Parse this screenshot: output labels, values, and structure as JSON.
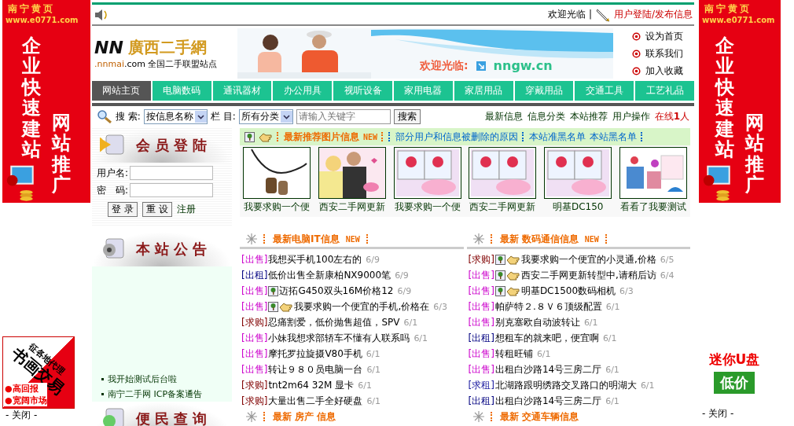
{
  "left_ads": {
    "banner": {
      "site": "南宁黄页",
      "url": "www.e0771.com",
      "slogan": "企业快速建站",
      "slogan2": "网站推广"
    },
    "float": {
      "tag": "征各地代理",
      "title": "书画交易",
      "points": [
        "●高回报",
        "●宽阔市场"
      ],
      "close": "- 关闭 -"
    }
  },
  "right_ads": {
    "banner": {
      "site": "南宁黄页",
      "url": "www.e0771.com",
      "slogan": "企业快速建站",
      "slogan2": "网站推广"
    },
    "float": {
      "title": "迷你U盘",
      "price": "低价",
      "close": "- 关闭 -"
    }
  },
  "header": {
    "welcome": "欢迎光临 |",
    "login_link": "用户登陆/发布信息"
  },
  "logo": {
    "mark": "NN",
    "name": "廣西二手網",
    "domain": ".nnmai",
    "suffix": ".com 全国二手联盟站点"
  },
  "banner": {
    "kind": "picture",
    "welcome": "欢迎光临:",
    "site": "nngw.cn"
  },
  "quick_links": [
    "设为首页",
    "联系我们",
    "加入收藏"
  ],
  "nav": [
    {
      "label": "网站主页",
      "selected": true
    },
    {
      "label": "电脑数码",
      "selected": false
    },
    {
      "label": "通讯器材",
      "selected": false
    },
    {
      "label": "办公用具",
      "selected": false
    },
    {
      "label": "视听设备",
      "selected": false
    },
    {
      "label": "家用电器",
      "selected": false
    },
    {
      "label": "家居用品",
      "selected": false
    },
    {
      "label": "穿戴用品",
      "selected": false
    },
    {
      "label": "交通工具",
      "selected": false
    },
    {
      "label": "工艺礼品",
      "selected": false
    }
  ],
  "search": {
    "label": "搜 索:",
    "field_select": "按信息名称",
    "column_label": "栏 目:",
    "category_select": "所有分类",
    "placeholder": "请输入关键字",
    "button": "搜索",
    "links": [
      "最新信息",
      "信息分类",
      "本站推荐",
      "用户操作"
    ],
    "online": "在线**1**人"
  },
  "login": {
    "title": "会员登陆",
    "username_label": "用户名:",
    "password_label": "密　码:",
    "login_button": "登 录",
    "reset_button": "重 设",
    "register": "注册"
  },
  "notice": {
    "title": "本站公告",
    "items": [
      "我开始测试后台啦",
      "南宁二手网 ICP备案通告"
    ]
  },
  "services": {
    "title": "便民查询"
  },
  "featured": {
    "title": "最新推荐图片信息",
    "badge": "NEW",
    "links": [
      "部分用户和信息被删除的原因",
      "本站准黑名单",
      "本站黑名单"
    ],
    "items": [
      {
        "caption": "我要求购一个便"
      },
      {
        "caption": "西安二手网更新"
      },
      {
        "caption": "我要求购一个便"
      },
      {
        "caption": "西安二手网更新"
      },
      {
        "caption": "明基DC150"
      },
      {
        "caption": "看看了我要测试"
      }
    ]
  },
  "sections": [
    {
      "title": "最新电脑IT信息",
      "badge": "NEW",
      "items": [
        {
          "tag": "[出售]",
          "color": "#cc00cc",
          "photo": false,
          "hot": false,
          "title": "我想买手机100左右的",
          "date": "6/9"
        },
        {
          "tag": "[出租]",
          "color": "#000080",
          "photo": false,
          "hot": false,
          "title": "低价出售全新康柏NX9000笔",
          "date": "6/9"
        },
        {
          "tag": "[出售]",
          "color": "#cc00cc",
          "photo": true,
          "hot": false,
          "title": "迈拓G450双头16M价格12",
          "date": "6/9"
        },
        {
          "tag": "[出售]",
          "color": "#cc00cc",
          "photo": true,
          "hot": true,
          "title": "我要求购一个便宜的手机,价格在",
          "date": "6/3"
        },
        {
          "tag": "[求购]",
          "color": "#800000",
          "photo": false,
          "hot": false,
          "title": "忍痛割爱，低价抛售超值，SPV",
          "date": "6/1"
        },
        {
          "tag": "[出售]",
          "color": "#cc00cc",
          "photo": false,
          "hot": false,
          "title": "小妹我想求部轿车不懂有人联系吗",
          "date": "6/1"
        },
        {
          "tag": "[出售]",
          "color": "#cc00cc",
          "photo": false,
          "hot": false,
          "title": "摩托罗拉旋摄V80手机",
          "date": "6/1"
        },
        {
          "tag": "[出售]",
          "color": "#cc00cc",
          "photo": false,
          "hot": false,
          "title": "转让９８０员电脑一台",
          "date": "6/1"
        },
        {
          "tag": "[求购]",
          "color": "#800000",
          "photo": false,
          "hot": false,
          "title": "tnt2m64 32M 显卡",
          "date": "6/1"
        },
        {
          "tag": "[求购]",
          "color": "#800000",
          "photo": false,
          "hot": false,
          "title": "大量出售二手全好硬盘",
          "date": "6/1"
        }
      ]
    },
    {
      "title": "最新 数码通信信息",
      "badge": "NEW",
      "items": [
        {
          "tag": "[求购]",
          "color": "#800000",
          "photo": true,
          "hot": true,
          "title": "我要求购一个便宜的小灵通,价格",
          "date": "6/5"
        },
        {
          "tag": "[出售]",
          "color": "#cc00cc",
          "photo": true,
          "hot": true,
          "title": "西安二手网更新转型中,请稍后访",
          "date": "6/4"
        },
        {
          "tag": "[出售]",
          "color": "#cc00cc",
          "photo": true,
          "hot": true,
          "title": "明基DC1500数码相机",
          "date": "6/3"
        },
        {
          "tag": "[出售]",
          "color": "#cc00cc",
          "photo": false,
          "hot": false,
          "title": "帕萨特２.８Ｖ６顶级配置",
          "date": "6/1"
        },
        {
          "tag": "[出售]",
          "color": "#cc00cc",
          "photo": false,
          "hot": false,
          "title": "别克塞欧自动波转让",
          "date": "6/1"
        },
        {
          "tag": "[出租]",
          "color": "#000080",
          "photo": false,
          "hot": false,
          "title": "想租车的就来吧，便宜啊",
          "date": "6/1"
        },
        {
          "tag": "[出售]",
          "color": "#cc00cc",
          "photo": false,
          "hot": false,
          "title": "转租旺铺",
          "date": "6/1"
        },
        {
          "tag": "[出售]",
          "color": "#cc00cc",
          "photo": false,
          "hot": false,
          "title": "出租白沙路14号三房二厅",
          "date": "6/1"
        },
        {
          "tag": "[求租]",
          "color": "#1a1aa0",
          "photo": false,
          "hot": false,
          "title": "北湖路跟明绣路交叉路口的明湖大",
          "date": "6/1"
        },
        {
          "tag": "[出租]",
          "color": "#000080",
          "photo": false,
          "hot": false,
          "title": "出租白沙路14号三房二厅",
          "date": "6/1"
        }
      ]
    }
  ],
  "next_sections": [
    "最新 房产 信息",
    "最新 交通车辆信息"
  ]
}
